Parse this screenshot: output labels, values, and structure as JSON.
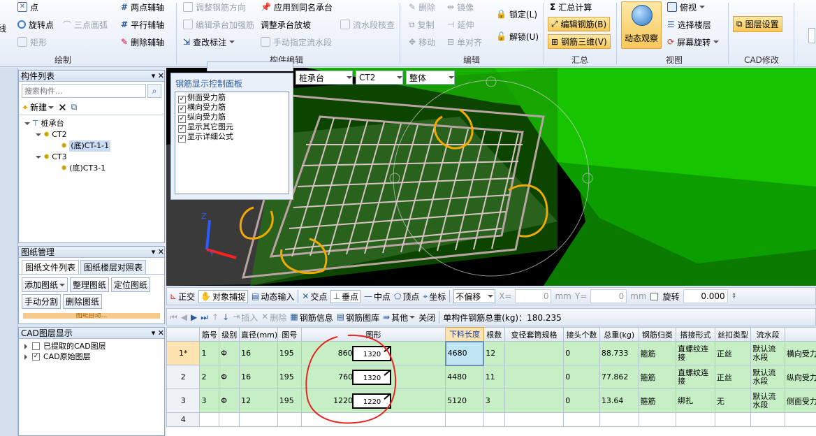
{
  "ribbon": {
    "draw": [
      "点",
      "旋转点",
      "三点画弧",
      "矩形",
      "两点辅轴",
      "平行辅轴",
      "删除辅轴"
    ],
    "draw_left_cut": "线",
    "edit_comp": [
      "调整钢筋方向",
      "编辑承台加强筋",
      "查改标注",
      "应用到同名承台",
      "调整承台放坡",
      "手动指定流水段",
      "流水段核查"
    ],
    "edit": [
      "删除",
      "复制",
      "移动",
      "镜像",
      "延伸",
      "单对齐",
      "锁定(L)",
      "解锁(U)"
    ],
    "summary": [
      "汇总计算",
      "编辑钢筋(B)",
      "钢筋三维(V)"
    ],
    "view": [
      "动态观察",
      "俯视",
      "选择楼层",
      "屏幕旋转"
    ],
    "cad": [
      "图层设置"
    ],
    "groups": [
      "绘制",
      "构件编辑",
      "编辑",
      "汇总",
      "视图",
      "CAD修改"
    ]
  },
  "comp_list": {
    "title": "构件列表",
    "search_placeholder": "搜索构件...",
    "new_label": "新建",
    "tree": [
      "桩承台",
      "CT2",
      "(底)CT-1-1",
      "CT3",
      "(底)CT3-1"
    ]
  },
  "drawing_mgmt": {
    "title": "图纸管理",
    "tabs": [
      "图纸文件列表",
      "图纸楼层对照表"
    ],
    "buttons": [
      "添加图纸",
      "整理图纸",
      "定位图纸",
      "手动分割",
      "删除图纸"
    ],
    "cut_label": "图纸自动..."
  },
  "cad_layers": {
    "title": "CAD图层显示",
    "items": [
      "已提取的CAD图层",
      "CAD原始图层"
    ]
  },
  "rebar_panel": {
    "title": "钢筋显示控制面板",
    "items": [
      "侧面受力筋",
      "横向受力筋",
      "纵向受力筋",
      "显示其它图元",
      "显示详细公式"
    ]
  },
  "viewport_bar": {
    "combos": [
      "桩承台",
      "CT2",
      "整体"
    ]
  },
  "snap_bar": {
    "items": [
      "正交",
      "对象捕捉",
      "动态输入",
      "交点",
      "垂点",
      "中点",
      "顶点",
      "坐标"
    ],
    "offset_select": "不偏移",
    "x_label": "X=",
    "x_value": "0",
    "y_label": "Y=",
    "y_value": "0",
    "unit": "mm",
    "rotate_label": "旋转",
    "rotate_value": "0.000"
  },
  "table_bar": {
    "items": [
      "插入",
      "删除",
      "钢筋信息",
      "钢筋图库",
      "其他",
      "关闭"
    ],
    "total_label": "单构件钢筋总重(kg)：180.235"
  },
  "table": {
    "headers": [
      "筋号",
      "级别",
      "直径(mm)",
      "图号",
      "图形",
      "下料长度",
      "根数",
      "变径套筒规格",
      "接头个数",
      "总重(kg)",
      "钢筋归类",
      "搭接形式",
      "丝扣类型",
      "流水段",
      ""
    ],
    "rows": [
      {
        "idx": "1*",
        "no": "1",
        "grade": "Φ",
        "dia": "16",
        "fig": "195",
        "shape_left": "860",
        "shape_inner": "1320",
        "len": "4680",
        "count": "12",
        "spec": "",
        "joints": "0",
        "weight": "88.733",
        "cls": "箍筋",
        "lap": "直螺纹连接",
        "thread": "正丝",
        "flow": "默认流水段",
        "name": "横向受力筋"
      },
      {
        "idx": "2",
        "no": "2",
        "grade": "Φ",
        "dia": "16",
        "fig": "195",
        "shape_left": "760",
        "shape_inner": "1320",
        "len": "4480",
        "count": "11",
        "spec": "",
        "joints": "0",
        "weight": "77.862",
        "cls": "箍筋",
        "lap": "直螺纹连接",
        "thread": "正丝",
        "flow": "默认流水段",
        "name": "纵向受力筋"
      },
      {
        "idx": "3",
        "no": "3",
        "grade": "Φ",
        "dia": "12",
        "fig": "195",
        "shape_left": "1220",
        "shape_inner": "1220",
        "len": "5120",
        "count": "3",
        "spec": "",
        "joints": "0",
        "weight": "13.64",
        "cls": "箍筋",
        "lap": "绑扎",
        "thread": "无",
        "flow": "默认流水段",
        "name": "侧面受力筋"
      },
      {
        "idx": "4",
        "no": "",
        "grade": "",
        "dia": "",
        "fig": "",
        "shape_left": "",
        "shape_inner": "",
        "len": "",
        "count": "",
        "spec": "",
        "joints": "",
        "weight": "",
        "cls": "",
        "lap": "",
        "thread": "",
        "flow": "",
        "name": ""
      }
    ]
  }
}
